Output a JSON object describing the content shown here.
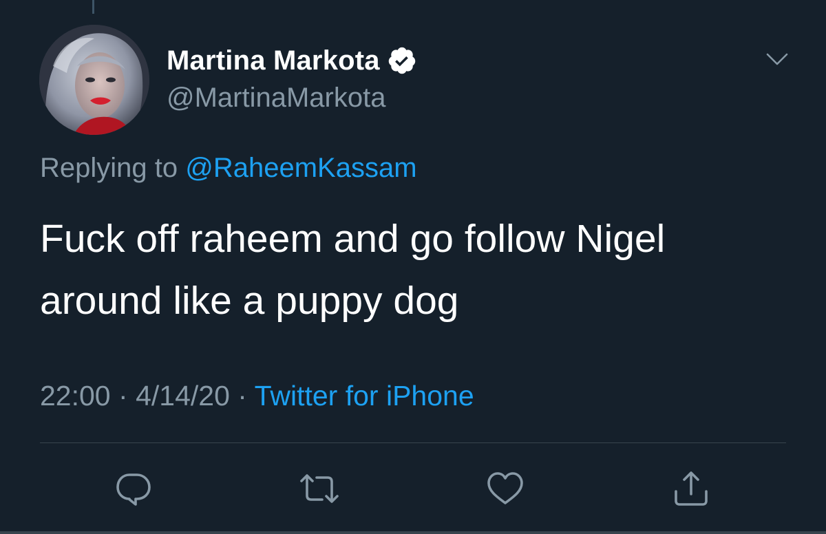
{
  "colors": {
    "background": "#15202b",
    "text_primary": "#ffffff",
    "text_secondary": "#8899a6",
    "accent": "#1da1f2",
    "divider": "#38444d"
  },
  "tweet": {
    "author": {
      "display_name": "Martina Markota",
      "handle": "@MartinaMarkota",
      "verified_icon": "verified-badge-icon",
      "avatar_icon": "profile-photo"
    },
    "reply": {
      "prefix": "Replying to",
      "mention": "@RaheemKassam"
    },
    "text_line1": "Fuck off raheem and go follow Nigel",
    "text_line2": "around like a puppy dog",
    "time": "22:00",
    "date": "4/14/20",
    "separator": "·",
    "source": "Twitter for iPhone"
  },
  "menu": {
    "icon": "chevron-down-icon"
  },
  "actions": [
    {
      "name": "reply",
      "icon": "comment-icon"
    },
    {
      "name": "retweet",
      "icon": "retweet-icon"
    },
    {
      "name": "like",
      "icon": "heart-icon"
    },
    {
      "name": "share",
      "icon": "share-icon"
    }
  ]
}
